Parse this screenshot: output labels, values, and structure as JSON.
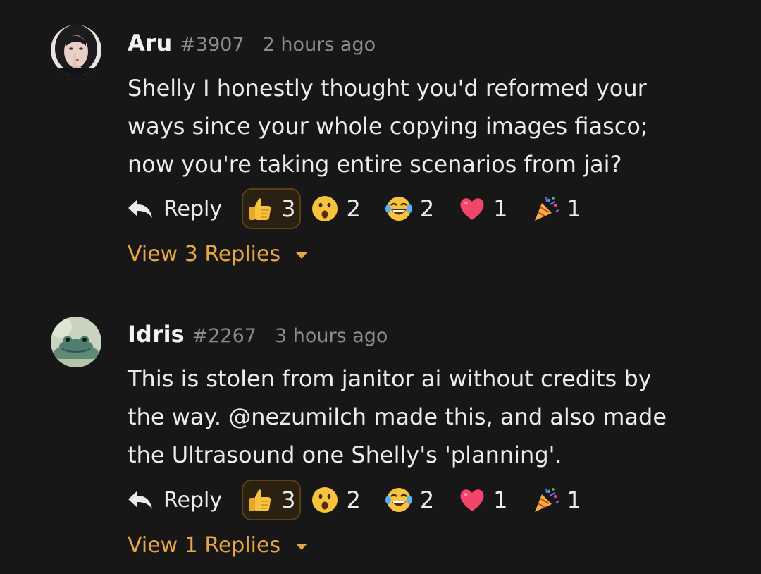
{
  "comments": [
    {
      "username": "Aru",
      "user_id": "#3907",
      "timestamp": "2 hours ago",
      "text": "Shelly I honestly thought you'd reformed your ways since your whole copying images fiasco; now you're taking entire scenarios from jai?",
      "reply_label": "Reply",
      "reactions": [
        {
          "icon": "thumbs-up-icon",
          "count": "3",
          "selected": true
        },
        {
          "icon": "surprised-face-icon",
          "count": "2"
        },
        {
          "icon": "laughing-tears-icon",
          "count": "2"
        },
        {
          "icon": "heart-icon",
          "count": "1"
        },
        {
          "icon": "party-popper-icon",
          "count": "1"
        }
      ],
      "view_replies": "View 3 Replies"
    },
    {
      "username": "Idris",
      "user_id": "#2267",
      "timestamp": "3 hours ago",
      "text": "This is stolen from janitor ai without credits by the way. @nezumilch made this, and also made the Ultrasound one Shelly's 'planning'.",
      "reply_label": "Reply",
      "reactions": [
        {
          "icon": "thumbs-up-icon",
          "count": "3",
          "selected": true
        },
        {
          "icon": "surprised-face-icon",
          "count": "2"
        },
        {
          "icon": "laughing-tears-icon",
          "count": "2"
        },
        {
          "icon": "heart-icon",
          "count": "1"
        },
        {
          "icon": "party-popper-icon",
          "count": "1"
        }
      ],
      "view_replies": "View 1 Replies"
    }
  ],
  "colors": {
    "background": "#171717",
    "accent": "#e8a646",
    "muted_text": "#8c8c8c",
    "selected_reaction_bg": "#2b2112"
  }
}
